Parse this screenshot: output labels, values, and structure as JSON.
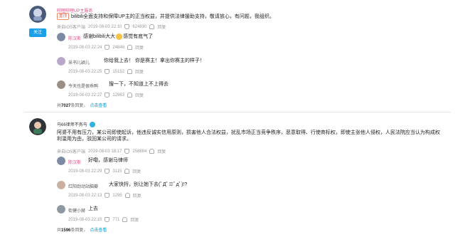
{
  "thread1": {
    "author": "哔哩哔哩UP主服务",
    "follow_label": "关注",
    "tag": "置顶",
    "content": "bilibili全面支持和保障UP主的正当权益，并提供法律援助支持，敬请放心，有问题，我组织。",
    "meta": {
      "source": "来自iOS客户端",
      "date": "2019-08-03 22:10",
      "likes": "624830",
      "reply": "回复"
    },
    "replies": [
      {
        "user": "陈汉斯",
        "content": "感谢bilibili大大",
        "content_after": "感觉有底气了",
        "date": "2019-08-03 22:24",
        "likes": "24848",
        "reply": "回复"
      },
      {
        "user": "采书儿颖儿",
        "content": "你给我上去！ 你是赛主！拿出你赛主的样子！",
        "date": "2019-08-03 22:25",
        "likes": "15152",
        "reply": "回复"
      },
      {
        "user": "今天也是很乖鸭",
        "content": "搜一下，不知道上不上得去",
        "date": "2019-08-03 22:27",
        "likes": "12963",
        "reply": "回复"
      }
    ],
    "summary": {
      "prefix": "共",
      "count": "7027",
      "suffix": "条回复，",
      "more": "点击查看"
    }
  },
  "thread2": {
    "author": "马66律师不务马",
    "content": "阿婆不用有压力，某公司即使起诉，他违反诚实信用原则，损害他人合法权益，扰乱市场正当竞争秩序，恶意取得、行使商标权，即使主张他人侵权，人民法院应当认为构成权利滥用为由，驳回某公司的请求。",
    "meta": {
      "source": "来自iOS客户端",
      "date": "2019-08-03 18:17",
      "likes": "258884",
      "reply": "回复"
    },
    "replies": [
      {
        "user": "陈汉斯",
        "content": "好嘞，感谢马律师",
        "date": "2019-08-03 22:29",
        "likes": "3115",
        "reply": "回复"
      },
      {
        "user": "红阳劲动站脑瓣",
        "content": "大家快捋，别让她下去(ﾟДﾟ≡ﾟдﾟ)!?",
        "date": "2019-08-03 22:13",
        "likes": "1295",
        "reply": "回复"
      },
      {
        "user": "街健小赫",
        "content": "上去",
        "date": "2019-08-03 22:15",
        "likes": "771",
        "reply": "回复"
      }
    ],
    "summary": {
      "prefix": "共",
      "count": "1596",
      "suffix": "条回复，",
      "more": "点击查看"
    }
  }
}
